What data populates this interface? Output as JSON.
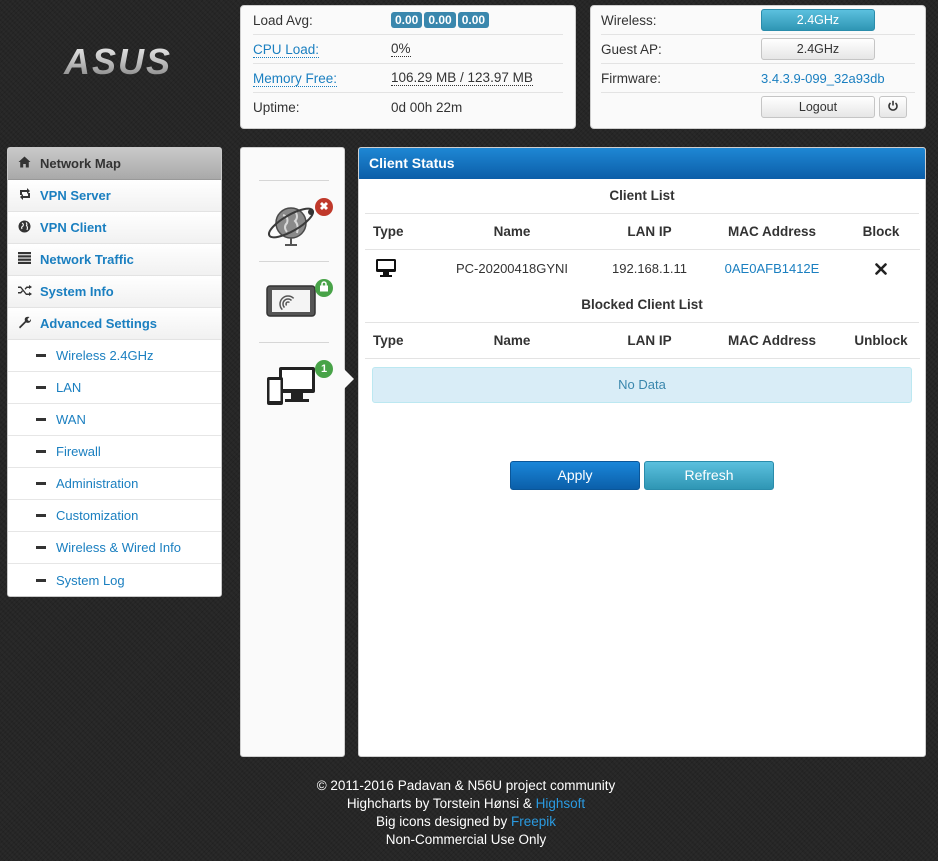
{
  "logo_text": "ASUS",
  "system": {
    "load_avg_label": "Load Avg:",
    "load_avg_values": [
      "0.00",
      "0.00",
      "0.00"
    ],
    "cpu_label": "CPU Load:",
    "cpu_value": "0%",
    "mem_label": "Memory Free:",
    "mem_value": "106.29 MB / 123.97 MB",
    "uptime_label": "Uptime:",
    "uptime_value": "0d 00h 22m"
  },
  "network": {
    "wireless_label": "Wireless:",
    "wireless_btn": "2.4GHz",
    "guest_label": "Guest AP:",
    "guest_btn": "2.4GHz",
    "firmware_label": "Firmware:",
    "firmware_value": "3.4.3.9-099_32a93db",
    "logout_label": "Logout",
    "power_icon": "power-icon"
  },
  "sidebar": {
    "items": [
      {
        "label": "Network Map",
        "icon": "home-icon"
      },
      {
        "label": "VPN Server",
        "icon": "retweet-icon"
      },
      {
        "label": "VPN Client",
        "icon": "globe-icon"
      },
      {
        "label": "Network Traffic",
        "icon": "list-icon"
      },
      {
        "label": "System Info",
        "icon": "random-icon"
      },
      {
        "label": "Advanced Settings",
        "icon": "wrench-icon"
      }
    ],
    "sub_items": [
      "Wireless 2.4GHz",
      "LAN",
      "WAN",
      "Firewall",
      "Administration",
      "Customization",
      "Wireless & Wired Info",
      "System Log"
    ]
  },
  "devices": {
    "internet_badge": "✖",
    "wireless_badge": "lock",
    "clients_badge": "1"
  },
  "client_status": {
    "title": "Client Status",
    "client_list_title": "Client List",
    "columns": [
      "Type",
      "Name",
      "LAN IP",
      "MAC Address",
      "Block"
    ],
    "rows": [
      {
        "type_icon": "desktop-icon",
        "name": "PC-20200418GYNI",
        "ip": "192.168.1.11",
        "mac": "0AE0AFB1412E",
        "action_icon": "remove-icon"
      }
    ],
    "blocked_title": "Blocked Client List",
    "blocked_columns": [
      "Type",
      "Name",
      "LAN IP",
      "MAC Address",
      "Unblock"
    ],
    "no_data": "No Data",
    "apply_label": "Apply",
    "refresh_label": "Refresh"
  },
  "footer": {
    "line1": "© 2011-2016 Padavan & N56U project community",
    "line2_prefix": "Highcharts by Torstein Hønsi & ",
    "line2_link": "Highsoft",
    "line3_prefix": "Big icons designed by ",
    "line3_link": "Freepik",
    "line4": "Non-Commercial Use Only"
  },
  "colors": {
    "accent_blue": "#1a7fc0",
    "header_blue": "#0c5ea8",
    "badge_blue": "#3a87ad",
    "info_bg": "#d9edf7"
  }
}
